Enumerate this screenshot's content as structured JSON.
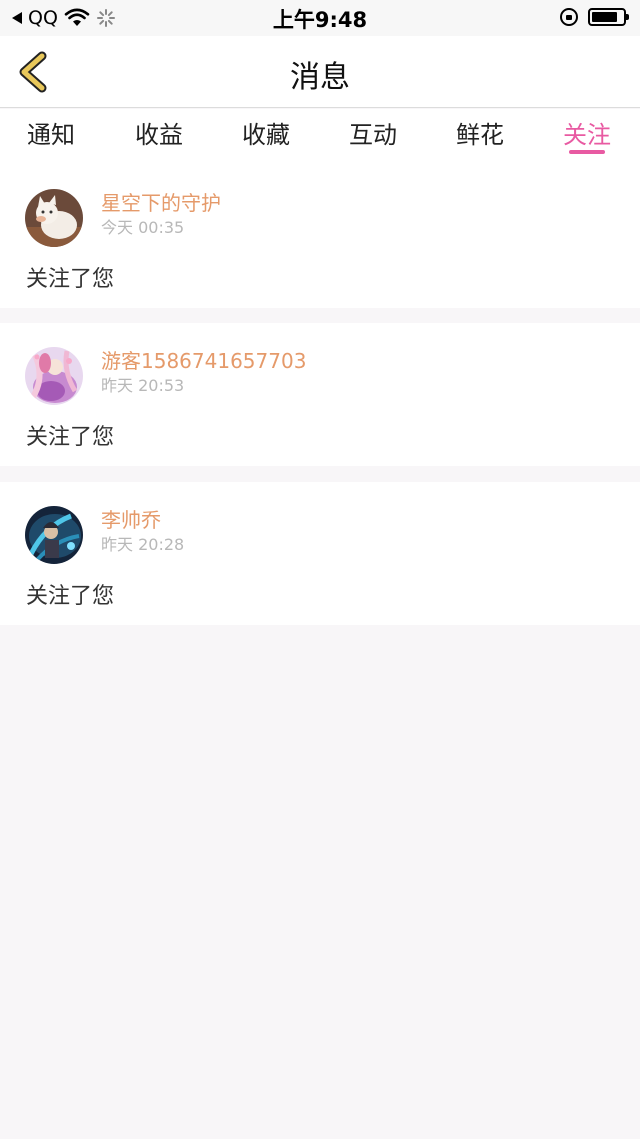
{
  "status": {
    "back_app": "QQ",
    "time": "上午9:48"
  },
  "nav": {
    "title": "消息"
  },
  "tabs": [
    {
      "label": "通知"
    },
    {
      "label": "收益"
    },
    {
      "label": "收藏"
    },
    {
      "label": "互动"
    },
    {
      "label": "鲜花"
    },
    {
      "label": "关注"
    }
  ],
  "active_tab": "关注",
  "colors": {
    "accent": "#e85aa2",
    "username": "#e59a6a",
    "time": "#b8b8b8",
    "back_arrow": "#e8c75a"
  },
  "messages": [
    {
      "name": "星空下的守护",
      "time": "今天 00:35",
      "text": "关注了您"
    },
    {
      "name": "游客1586741657703",
      "time": "昨天 20:53",
      "text": "关注了您"
    },
    {
      "name": "李帅乔",
      "time": "昨天 20:28",
      "text": "关注了您"
    }
  ]
}
